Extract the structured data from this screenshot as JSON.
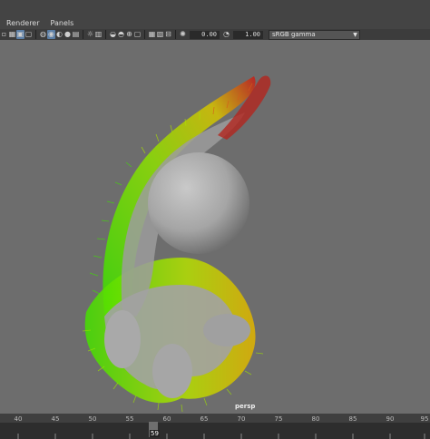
{
  "menu": {
    "items": [
      "Renderer",
      "Panels"
    ]
  },
  "toolbar": {
    "left_icons": [
      "frame-icon",
      "grid-icon",
      "select-camera-icon",
      "wireframe-icon",
      "smooth-shade-icon",
      "textured-icon",
      "lighting-icon",
      "shadows-icon",
      "ao-icon",
      "motion-blur-icon",
      "aa-icon",
      "isolate-icon",
      "xray-icon",
      "xray-joints-icon",
      "xray-active-icon",
      "film-gate-icon",
      "resolution-gate-icon",
      "safe-action-icon"
    ],
    "exposure_value": "0.00",
    "gamma_value": "1.00",
    "color_space": "sRGB gamma"
  },
  "viewport": {
    "camera_label": "persp"
  },
  "timeline": {
    "tick_labels": [
      "40",
      "45",
      "50",
      "55",
      "60",
      "65",
      "70",
      "75",
      "80",
      "85",
      "90",
      "95"
    ],
    "current_frame": "59"
  }
}
